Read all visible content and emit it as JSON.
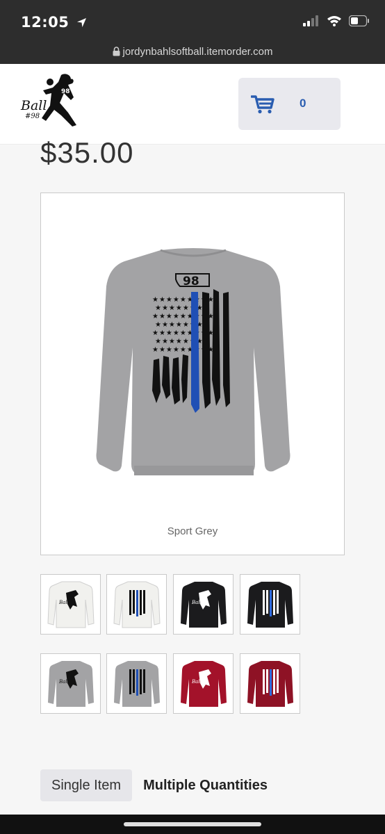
{
  "status_bar": {
    "time": "12:05"
  },
  "browser": {
    "url": "jordynbahlsoftball.itemorder.com"
  },
  "header": {
    "logo_text": "Ball",
    "logo_number": "#98",
    "cart_count": "0"
  },
  "product": {
    "price": "$35.00",
    "selected_color": "Sport Grey",
    "print_number": "98"
  },
  "thumbnails": [
    {
      "color": "White",
      "design": "pitcher"
    },
    {
      "color": "White",
      "design": "flag"
    },
    {
      "color": "Black",
      "design": "pitcher"
    },
    {
      "color": "Black",
      "design": "flag"
    },
    {
      "color": "Sport Grey",
      "design": "pitcher"
    },
    {
      "color": "Sport Grey",
      "design": "flag"
    },
    {
      "color": "Cardinal",
      "design": "pitcher"
    },
    {
      "color": "Cardinal",
      "design": "flag"
    }
  ],
  "colors": {
    "accent": "#2a5db0",
    "sport_grey": "#a3a3a5",
    "white": "#f1f1ee",
    "black": "#1b1b1d",
    "cardinal": "#a3122a",
    "thin_blue_line": "#1f4fb5"
  },
  "quantity_mode": {
    "single": "Single Item",
    "multiple": "Multiple Quantities"
  }
}
